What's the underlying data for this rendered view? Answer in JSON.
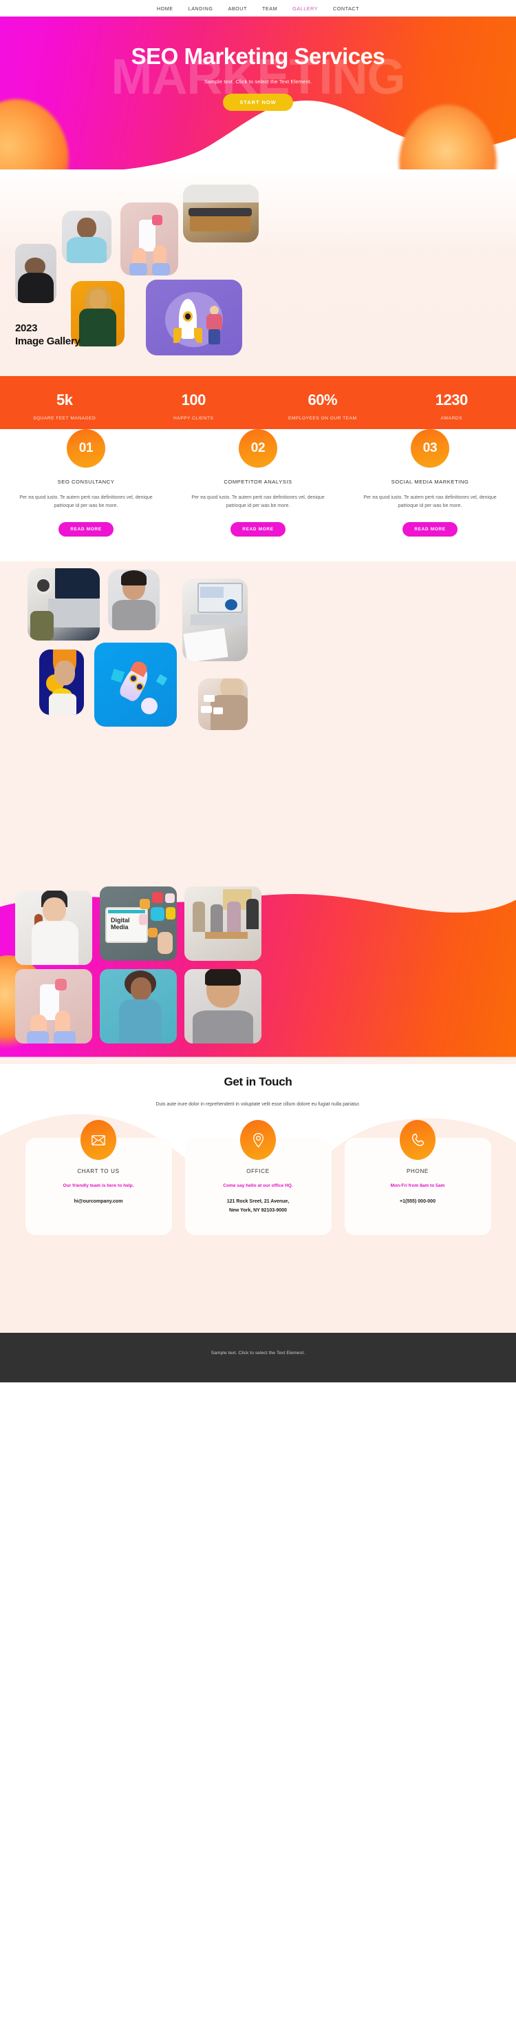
{
  "nav": {
    "items": [
      {
        "label": "HOME",
        "active": false
      },
      {
        "label": "LANDING",
        "active": false
      },
      {
        "label": "ABOUT",
        "active": false
      },
      {
        "label": "TEAM",
        "active": false
      },
      {
        "label": "GALLERY",
        "active": true
      },
      {
        "label": "CONTACT",
        "active": false
      }
    ]
  },
  "hero": {
    "ghost_text": "MARKETING",
    "title": "SEO Marketing Services",
    "subtitle": "Sample text. Click to select the Text Element.",
    "cta_label": "START NOW",
    "cta_color": "#f2c20c",
    "gradient_from": "#f40fe0",
    "gradient_to": "#fb6a09"
  },
  "gallery_one": {
    "caption_year": "2023",
    "caption_title": "Image Gallery"
  },
  "stats": {
    "background": "#f9521b",
    "items": [
      {
        "value": "5k",
        "label": "SQUARE FEET MANAGED"
      },
      {
        "value": "100",
        "label": "HAPPY CLIENTS"
      },
      {
        "value": "60%",
        "label": "EMPLOYEES ON OUR TEAM"
      },
      {
        "value": "1230",
        "label": "AWARDS"
      }
    ]
  },
  "services": {
    "read_more_label": "READ MORE",
    "read_more_color": "#ee14d1",
    "items": [
      {
        "number": "01",
        "title": "SEO CONSULTANCY",
        "text": "Per ea quod iusto. Te autem perti nax definitiones vel, denique patrioque id per was be more."
      },
      {
        "number": "02",
        "title": "COMPETITOR ANALYSIS",
        "text": "Per ea quod iusto. Te autem perti nax definitiones vel, denique patrioque id per was be more."
      },
      {
        "number": "03",
        "title": "SOCIAL MEDIA MARKETING",
        "text": "Per ea quod iusto. Te autem perti nax definitiones vel, denique patrioque id per was be more."
      }
    ]
  },
  "digital_media_tile": {
    "line1": "Digital",
    "line2": "Media"
  },
  "contact": {
    "title": "Get in Touch",
    "subtitle": "Duis aute irure dolor in reprehenderit in voluptate velit esse cillum dolore eu fugiat nulla pariatur.",
    "cards": [
      {
        "icon": "envelope-icon",
        "title": "CHART TO US",
        "note": "Our friendly team is here to help.",
        "value": "hi@ourcompany.com"
      },
      {
        "icon": "map-pin-icon",
        "title": "OFFICE",
        "note": "Come say hello at our office HQ.",
        "value": "121 Rock Sreet, 21 Avenue,\nNew York, NY 92103-9000"
      },
      {
        "icon": "phone-icon",
        "title": "PHONE",
        "note": "Mon-Fri from 8am to 5am",
        "value": "+1(555) 000-000"
      }
    ]
  },
  "footer": {
    "text": "Sample text. Click to select the Text Element.",
    "background": "#333233"
  }
}
